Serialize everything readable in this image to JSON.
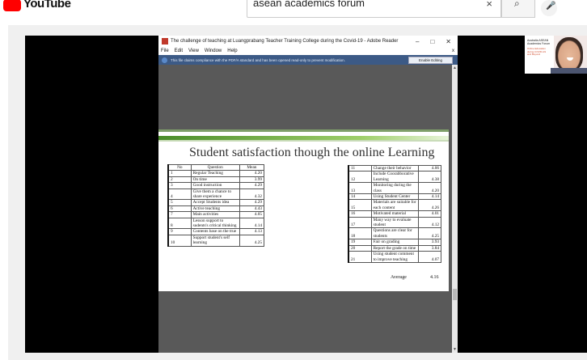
{
  "youtube": {
    "logo_text": "YouTube",
    "search_value": "asean academics forum",
    "clear_icon": "×",
    "search_icon": "⌕",
    "mic_icon": "🎤"
  },
  "reader": {
    "title": "The challenge of teaching at Luangprabang Teacher Training College during the Covid-19 - Adobe Reader",
    "window_controls": [
      "–",
      "□",
      "✕"
    ],
    "menu": [
      "File",
      "Edit",
      "View",
      "Window",
      "Help"
    ],
    "menu_close": "x",
    "notice": "This file claims compliance with the PDF/A standard and has been opened read-only to prevent modification.",
    "enable_editing": "Enable Editing"
  },
  "slide": {
    "title": "Student satisfaction though the online Learning",
    "headers": [
      "No",
      "Question",
      "Mean"
    ],
    "left_rows": [
      {
        "no": "1",
        "question": "Regular Teaching",
        "mean": "4.20"
      },
      {
        "no": "2",
        "question": "On time",
        "mean": "3.99"
      },
      {
        "no": "3",
        "question": "Good instruction",
        "mean": "4.29"
      },
      {
        "no": "4",
        "question": "Give them a chance to share experience",
        "mean": "4.32"
      },
      {
        "no": "5",
        "question": "Accept Students idea",
        "mean": "4.29"
      },
      {
        "no": "6",
        "question": "Active teaching",
        "mean": "4.43"
      },
      {
        "no": "7",
        "question": "Main activities",
        "mean": "4.05"
      },
      {
        "no": "8",
        "question": "Lesson support to sudents's critical thinking",
        "mean": "4.14"
      },
      {
        "no": "9",
        "question": "Contents base on the true",
        "mean": "4.13"
      },
      {
        "no": "10",
        "question": "Support student's self learning",
        "mean": "4.25"
      }
    ],
    "right_rows": [
      {
        "no": "11",
        "question": "Change their behavior",
        "mean": "4.06"
      },
      {
        "no": "12",
        "question": "Include Coorabborative Learning",
        "mean": "4.38"
      },
      {
        "no": "13",
        "question": "Monitoring during the class",
        "mean": "4.20"
      },
      {
        "no": "14",
        "question": "Using Student Center",
        "mean": "4.14"
      },
      {
        "no": "15",
        "question": "Materials are suitable for each content",
        "mean": "4.26"
      },
      {
        "no": "16",
        "question": "Motivated material",
        "mean": "4.01"
      },
      {
        "no": "17",
        "question": "Many way to evaluate student",
        "mean": "4.12"
      },
      {
        "no": "18",
        "question": "Questions are clear for students",
        "mean": "4.25"
      },
      {
        "no": "19",
        "question": "Fair on grading",
        "mean": "3.93"
      },
      {
        "no": "20",
        "question": "Report the grade on time",
        "mean": "3.84"
      },
      {
        "no": "21",
        "question": "Using student comment to improve teaching",
        "mean": "4.07"
      }
    ],
    "average_label": "Average",
    "average_value": "4.16"
  },
  "webcam": {
    "slide_title": "Australia ASEAN Academics Forum",
    "slide_text": "Online Education during COVID-19 and Beyond"
  }
}
